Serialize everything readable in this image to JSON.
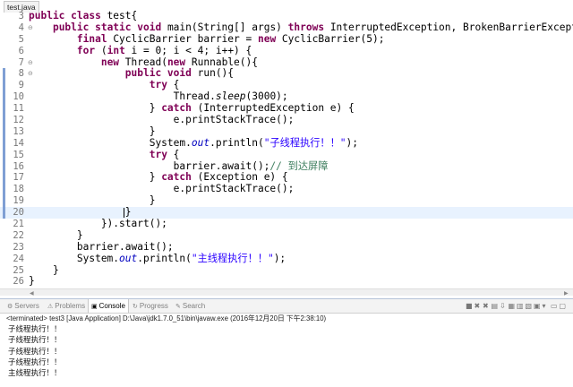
{
  "editor": {
    "tab_title": "test.java",
    "lines": [
      {
        "num": "3",
        "fold": "",
        "tokens": [
          {
            "t": "kw",
            "v": "public class "
          },
          {
            "t": "p",
            "v": "test{"
          }
        ]
      },
      {
        "num": "4",
        "fold": "⊖",
        "tokens": [
          {
            "t": "p",
            "v": "    "
          },
          {
            "t": "kw",
            "v": "public static void "
          },
          {
            "t": "p",
            "v": "main(String[] args) "
          },
          {
            "t": "kw",
            "v": "throws "
          },
          {
            "t": "p",
            "v": "InterruptedException, BrokenBarrierException {"
          }
        ]
      },
      {
        "num": "5",
        "fold": "",
        "tokens": [
          {
            "t": "p",
            "v": "        "
          },
          {
            "t": "kw",
            "v": "final "
          },
          {
            "t": "p",
            "v": "CyclicBarrier barrier = "
          },
          {
            "t": "kw",
            "v": "new "
          },
          {
            "t": "p",
            "v": "CyclicBarrier(5);"
          }
        ]
      },
      {
        "num": "6",
        "fold": "",
        "tokens": [
          {
            "t": "p",
            "v": "        "
          },
          {
            "t": "kw",
            "v": "for "
          },
          {
            "t": "p",
            "v": "("
          },
          {
            "t": "kw",
            "v": "int "
          },
          {
            "t": "p",
            "v": "i = 0; i < 4; i++) {"
          }
        ]
      },
      {
        "num": "7",
        "fold": "⊖",
        "tokens": [
          {
            "t": "p",
            "v": "            "
          },
          {
            "t": "kw",
            "v": "new "
          },
          {
            "t": "p",
            "v": "Thread("
          },
          {
            "t": "kw",
            "v": "new "
          },
          {
            "t": "p",
            "v": "Runnable(){"
          }
        ]
      },
      {
        "num": "8",
        "fold": "⊖",
        "marker": true,
        "tokens": [
          {
            "t": "p",
            "v": "                "
          },
          {
            "t": "kw",
            "v": "public void "
          },
          {
            "t": "p",
            "v": "run(){"
          }
        ]
      },
      {
        "num": "9",
        "fold": "",
        "marker": true,
        "tokens": [
          {
            "t": "p",
            "v": "                    "
          },
          {
            "t": "kw",
            "v": "try "
          },
          {
            "t": "p",
            "v": "{"
          }
        ]
      },
      {
        "num": "10",
        "fold": "",
        "marker": true,
        "tokens": [
          {
            "t": "p",
            "v": "                        Thread."
          },
          {
            "t": "itl",
            "v": "sleep"
          },
          {
            "t": "p",
            "v": "(3000);"
          }
        ]
      },
      {
        "num": "11",
        "fold": "",
        "marker": true,
        "tokens": [
          {
            "t": "p",
            "v": "                    } "
          },
          {
            "t": "kw",
            "v": "catch "
          },
          {
            "t": "p",
            "v": "(InterruptedException e) {"
          }
        ]
      },
      {
        "num": "12",
        "fold": "",
        "marker": true,
        "tokens": [
          {
            "t": "p",
            "v": "                        e.printStackTrace();"
          }
        ]
      },
      {
        "num": "13",
        "fold": "",
        "marker": true,
        "tokens": [
          {
            "t": "p",
            "v": "                    }"
          }
        ]
      },
      {
        "num": "14",
        "fold": "",
        "marker": true,
        "tokens": [
          {
            "t": "p",
            "v": "                    System."
          },
          {
            "t": "fld",
            "v": "out"
          },
          {
            "t": "p",
            "v": ".println("
          },
          {
            "t": "str",
            "v": "\"子线程执行！！\""
          },
          {
            "t": "p",
            "v": ");"
          }
        ]
      },
      {
        "num": "15",
        "fold": "",
        "marker": true,
        "tokens": [
          {
            "t": "p",
            "v": "                    "
          },
          {
            "t": "kw",
            "v": "try "
          },
          {
            "t": "p",
            "v": "{"
          }
        ]
      },
      {
        "num": "16",
        "fold": "",
        "marker": true,
        "tokens": [
          {
            "t": "p",
            "v": "                        barrier.await();"
          },
          {
            "t": "cmt",
            "v": "// 到达屏障"
          }
        ]
      },
      {
        "num": "17",
        "fold": "",
        "marker": true,
        "tokens": [
          {
            "t": "p",
            "v": "                    } "
          },
          {
            "t": "kw",
            "v": "catch "
          },
          {
            "t": "p",
            "v": "(Exception e) {"
          }
        ]
      },
      {
        "num": "18",
        "fold": "",
        "marker": true,
        "tokens": [
          {
            "t": "p",
            "v": "                        e.printStackTrace();"
          }
        ]
      },
      {
        "num": "19",
        "fold": "",
        "marker": true,
        "tokens": [
          {
            "t": "p",
            "v": "                    }"
          }
        ]
      },
      {
        "num": "20",
        "fold": "",
        "marker": true,
        "current": true,
        "tokens": [
          {
            "t": "p",
            "v": "                }"
          }
        ]
      },
      {
        "num": "21",
        "fold": "",
        "tokens": [
          {
            "t": "p",
            "v": "            }).start();"
          }
        ]
      },
      {
        "num": "22",
        "fold": "",
        "tokens": [
          {
            "t": "p",
            "v": "        }"
          }
        ]
      },
      {
        "num": "23",
        "fold": "",
        "tokens": [
          {
            "t": "p",
            "v": "        barrier.await();"
          }
        ]
      },
      {
        "num": "24",
        "fold": "",
        "tokens": [
          {
            "t": "p",
            "v": "        System."
          },
          {
            "t": "fld",
            "v": "out"
          },
          {
            "t": "p",
            "v": ".println("
          },
          {
            "t": "str",
            "v": "\"主线程执行！！\""
          },
          {
            "t": "p",
            "v": ");"
          }
        ]
      },
      {
        "num": "25",
        "fold": "",
        "tokens": [
          {
            "t": "p",
            "v": "    }"
          }
        ]
      },
      {
        "num": "26",
        "fold": "",
        "tokens": [
          {
            "t": "p",
            "v": "}"
          }
        ]
      }
    ]
  },
  "console": {
    "tabs": [
      {
        "label": "Servers",
        "icon": "servers-icon",
        "glyph": "⚙",
        "active": false
      },
      {
        "label": "Problems",
        "icon": "problems-icon",
        "glyph": "⚠",
        "active": false
      },
      {
        "label": "Console",
        "icon": "console-icon",
        "glyph": "▣",
        "active": true
      },
      {
        "label": "Progress",
        "icon": "progress-icon",
        "glyph": "↻",
        "active": false
      },
      {
        "label": "Search",
        "icon": "search-icon",
        "glyph": "✎",
        "active": false
      }
    ],
    "toolbar": [
      {
        "name": "terminate-icon",
        "glyph": "■"
      },
      {
        "name": "remove-launch-icon",
        "glyph": "✖"
      },
      {
        "name": "remove-all-icon",
        "glyph": "✖"
      },
      {
        "name": "clear-console-icon",
        "glyph": "▤"
      },
      {
        "name": "scroll-lock-icon",
        "glyph": "⇩"
      },
      {
        "name": "word-wrap-icon",
        "glyph": "▦"
      },
      {
        "name": "pin-console-icon",
        "glyph": "▥"
      },
      {
        "name": "show-on-output-icon",
        "glyph": "▧"
      },
      {
        "name": "display-console-icon",
        "glyph": "▣"
      },
      {
        "name": "open-console-icon",
        "glyph": "▾"
      },
      {
        "name": "minimize-icon",
        "glyph": "▭"
      },
      {
        "name": "maximize-icon",
        "glyph": "▢"
      }
    ],
    "terminated_line": "<terminated> test3 [Java Application] D:\\Java\\jdk1.7.0_51\\bin\\javaw.exe (2016年12月20日 下午2:38:10)",
    "output": [
      "子线程执行！！",
      "子线程执行！！",
      "子线程执行！！",
      "子线程执行！！",
      "主线程执行！！"
    ]
  },
  "colors": {
    "keyword": "#7f0055",
    "string": "#2a00ff",
    "field": "#0000c0",
    "comment": "#3f7f5f",
    "current_line": "#e8f2fe"
  }
}
